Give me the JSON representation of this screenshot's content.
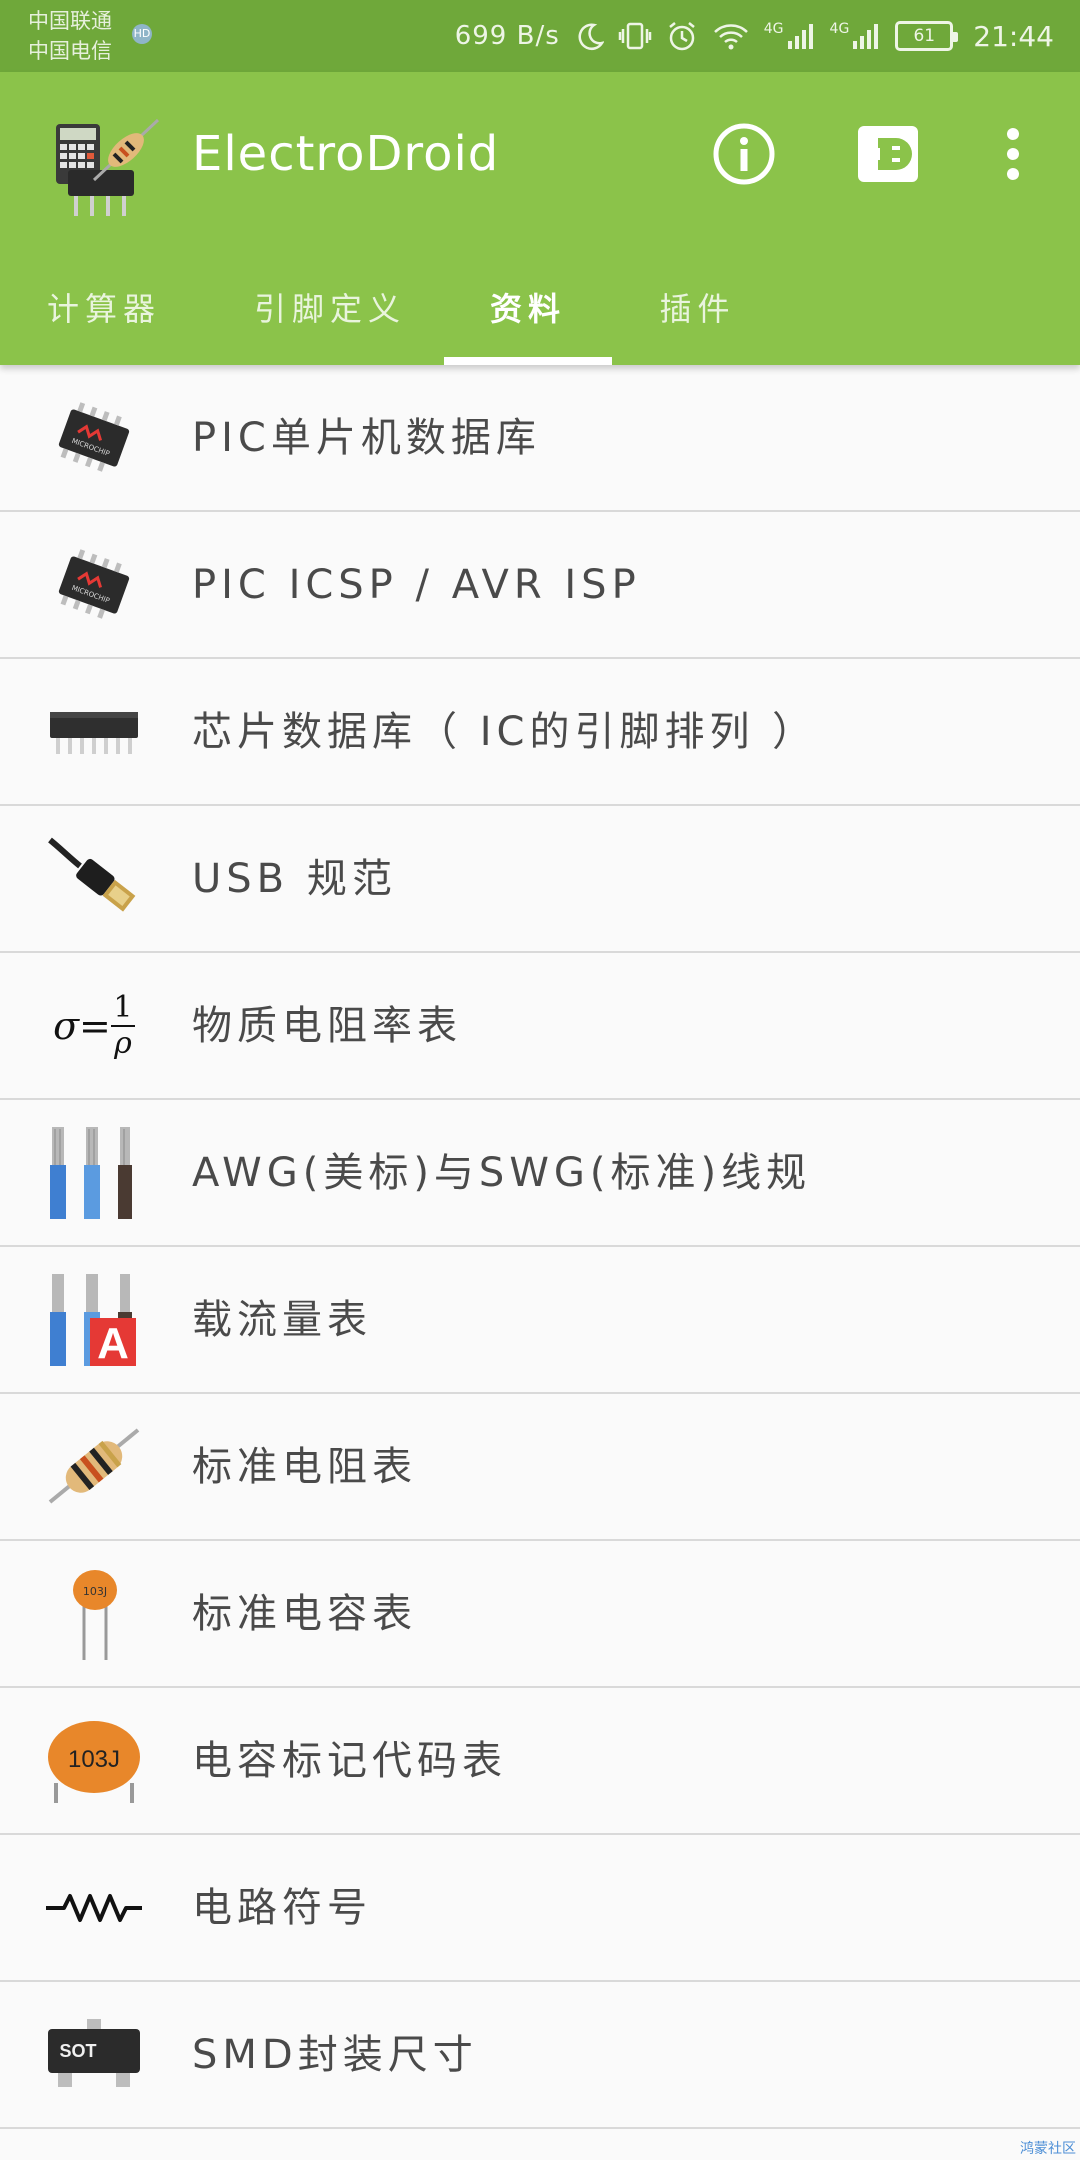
{
  "status_bar": {
    "carrier_1": "中国联通",
    "carrier_2": "中国电信",
    "carrier_badge": "HD",
    "net_speed": "699 B/s",
    "net_1": "4G",
    "net_2": "4G",
    "battery": "61",
    "time": "21:44"
  },
  "app": {
    "title": "ElectroDroid"
  },
  "tabs": [
    {
      "label": "计算器",
      "active": false
    },
    {
      "label": "引脚定义",
      "active": false
    },
    {
      "label": "资料",
      "active": true
    },
    {
      "label": "插件",
      "active": false
    }
  ],
  "list": [
    {
      "label": "PIC单片机数据库",
      "icon": "microchip-icon"
    },
    {
      "label": "PIC ICSP / AVR ISP",
      "icon": "microchip-icon"
    },
    {
      "label": "芯片数据库（ IC的引脚排列 ）",
      "icon": "dip-chip-icon"
    },
    {
      "label": "USB 规范",
      "icon": "usb-plug-icon"
    },
    {
      "label": "物质电阻率表",
      "icon": "conductivity-formula-icon"
    },
    {
      "label": "AWG(美标)与SWG(标准)线规",
      "icon": "wires-icon"
    },
    {
      "label": "载流量表",
      "icon": "ampacity-wires-icon"
    },
    {
      "label": "标准电阻表",
      "icon": "resistor-icon"
    },
    {
      "label": "标准电容表",
      "icon": "ceramic-capacitor-icon"
    },
    {
      "label": "电容标记代码表",
      "icon": "capacitor-code-icon"
    },
    {
      "label": "电路符号",
      "icon": "circuit-symbol-icon"
    },
    {
      "label": "SMD封装尺寸",
      "icon": "smd-package-icon"
    }
  ],
  "icon_text": {
    "formula_sigma": "σ=",
    "formula_num": "1",
    "formula_den": "ρ",
    "cap_code_small": "103J",
    "cap_code_big": "103J",
    "ampacity_letter": "A",
    "smd_text": "SOT"
  },
  "watermark": "鸿蒙社区",
  "colors": {
    "status_bar": "#6fa83a",
    "app_bar": "#8bc34a",
    "text_primary": "#4a4a4a",
    "divider": "#d9d9d9",
    "background": "#fafafa"
  }
}
